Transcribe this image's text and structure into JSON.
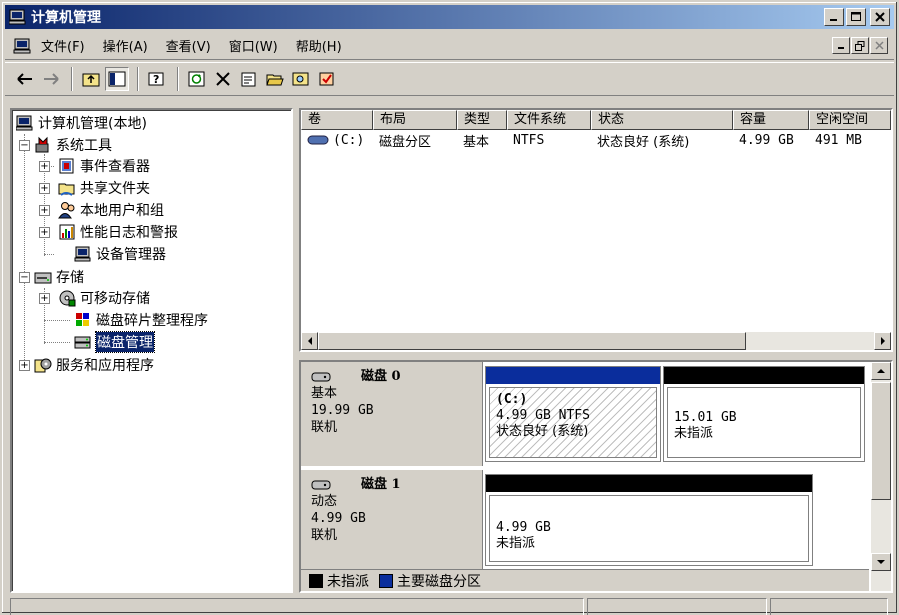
{
  "window": {
    "title": "计算机管理"
  },
  "menu": [
    "文件(F)",
    "操作(A)",
    "查看(V)",
    "窗口(W)",
    "帮助(H)"
  ],
  "tree": {
    "root": "计算机管理(本地)",
    "system_tools": "系统工具",
    "event_viewer": "事件查看器",
    "shared_folders": "共享文件夹",
    "local_users": "本地用户和组",
    "perf_logs": "性能日志和警报",
    "device_manager": "设备管理器",
    "storage": "存储",
    "removable": "可移动存储",
    "defrag": "磁盘碎片整理程序",
    "disk_mgmt": "磁盘管理",
    "services": "服务和应用程序"
  },
  "volumes": {
    "headers": [
      "卷",
      "布局",
      "类型",
      "文件系统",
      "状态",
      "容量",
      "空闲空间"
    ],
    "rows": [
      {
        "volume": "(C:)",
        "layout": "磁盘分区",
        "type": "基本",
        "fs": "NTFS",
        "status": "状态良好 (系统)",
        "capacity": "4.99 GB",
        "free": "491 MB"
      }
    ]
  },
  "disks": [
    {
      "name": "磁盘 0",
      "type": "基本",
      "size": "19.99 GB",
      "state": "联机",
      "partitions": [
        {
          "label": "(C:)",
          "info": "4.99 GB NTFS",
          "status": "状态良好 (系统)",
          "kind": "primary"
        },
        {
          "label": "",
          "info": "15.01 GB",
          "status": "未指派",
          "kind": "unallocated"
        }
      ]
    },
    {
      "name": "磁盘 1",
      "type": "动态",
      "size": "4.99 GB",
      "state": "联机",
      "partitions": [
        {
          "label": "",
          "info": "4.99 GB",
          "status": "未指派",
          "kind": "unallocated"
        }
      ]
    }
  ],
  "legend": [
    {
      "label": "未指派",
      "color": "#000000"
    },
    {
      "label": "主要磁盘分区",
      "color": "#0a2d9c"
    }
  ],
  "colors": {
    "titlebar": "#0a246a",
    "primary_partition": "#0a2d9c",
    "unallocated": "#000000"
  }
}
